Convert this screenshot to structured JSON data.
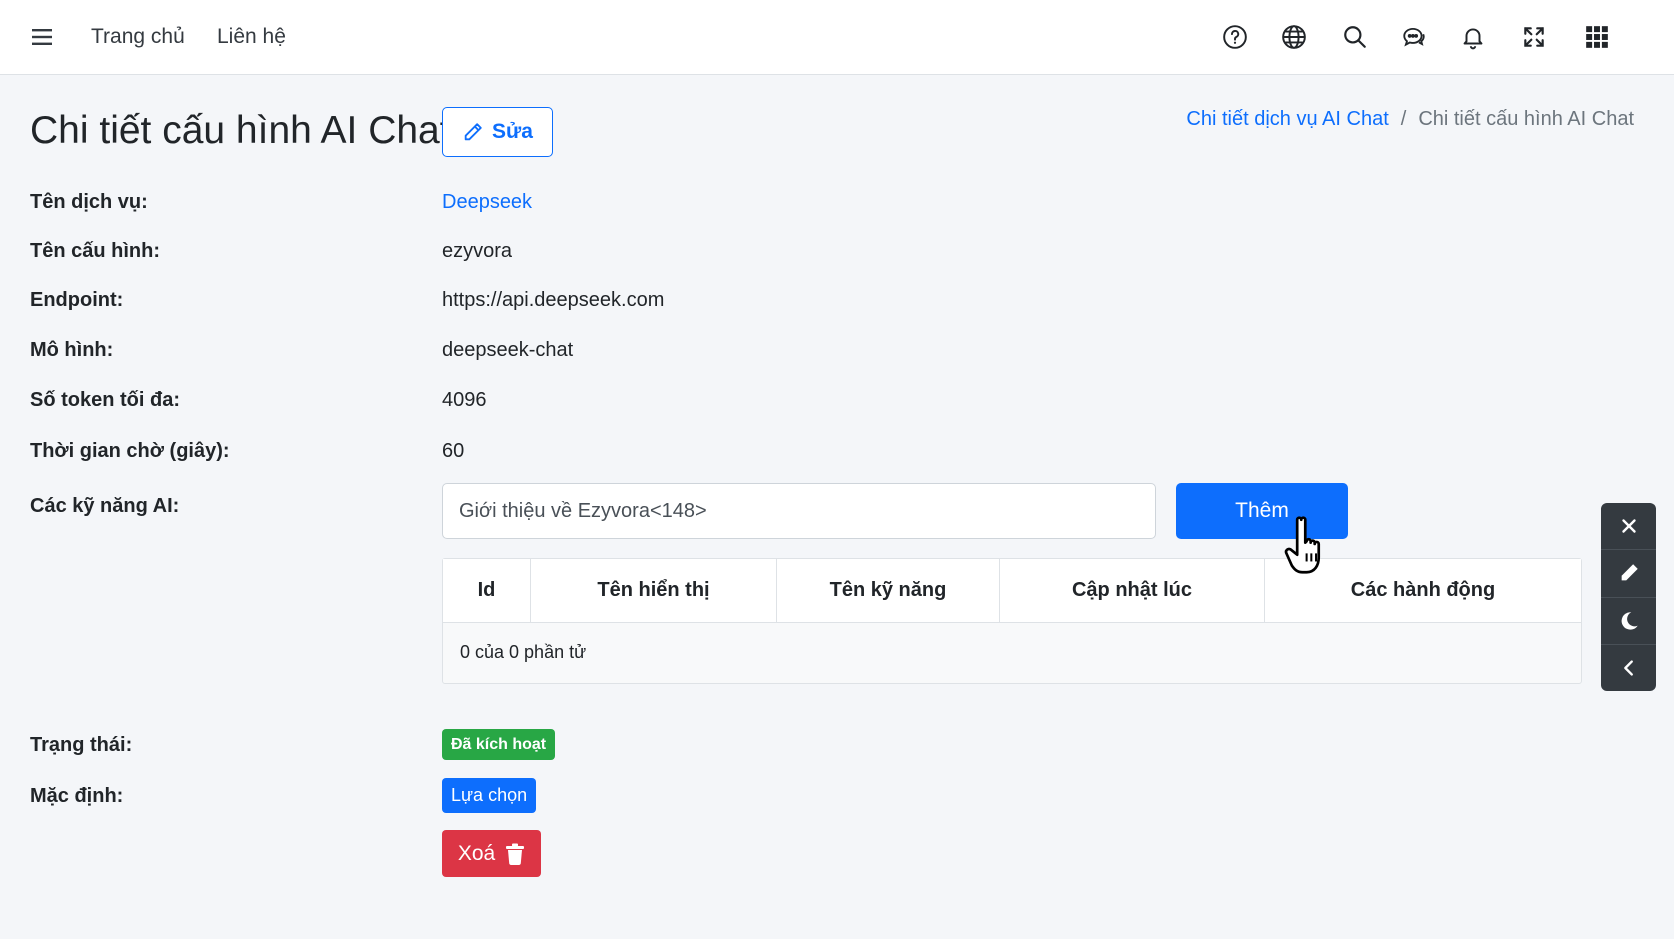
{
  "navbar": {
    "links": [
      "Trang chủ",
      "Liên hệ"
    ],
    "icons": [
      "help-icon",
      "globe-icon",
      "search-icon",
      "chat-icon",
      "bell-icon",
      "fullscreen-icon",
      "apps-grid-icon"
    ]
  },
  "header": {
    "title": "Chi tiết cấu hình AI Chat",
    "edit_label": "Sửa",
    "breadcrumb": {
      "parent": "Chi tiết dịch vụ AI Chat",
      "separator": "/",
      "current": "Chi tiết cấu hình AI Chat"
    }
  },
  "details": {
    "service_name": {
      "label": "Tên dịch vụ:",
      "value": "Deepseek"
    },
    "config_name": {
      "label": "Tên cấu hình:",
      "value": "ezyvora"
    },
    "endpoint": {
      "label": "Endpoint:",
      "value": "https://api.deepseek.com"
    },
    "model": {
      "label": "Mô hình:",
      "value": "deepseek-chat"
    },
    "max_tokens": {
      "label": "Số token tối đa:",
      "value": "4096"
    },
    "timeout": {
      "label": "Thời gian chờ (giây):",
      "value": "60"
    },
    "skills": {
      "label": "Các kỹ năng AI:"
    },
    "status": {
      "label": "Trạng thái:",
      "value": "Đã kích hoạt"
    },
    "default": {
      "label": "Mặc định:",
      "value": "Lựa chọn"
    }
  },
  "skills": {
    "input_value": "Giới thiệu về Ezyvora<148>",
    "add_label": "Thêm",
    "columns": [
      "Id",
      "Tên hiển thị",
      "Tên kỹ năng",
      "Cập nhật lúc",
      "Các hành động"
    ],
    "footer_text": "0 của 0 phần tử"
  },
  "actions": {
    "delete_label": "Xoá"
  },
  "colors": {
    "primary": "#0d6efd",
    "success": "#28a745",
    "danger": "#dc3545",
    "panel": "#343a40"
  }
}
